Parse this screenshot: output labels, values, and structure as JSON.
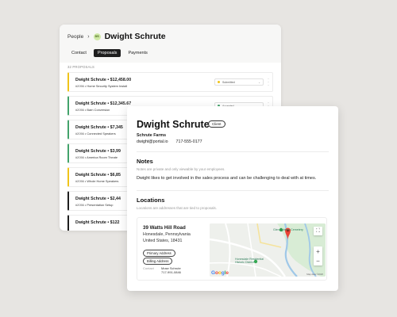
{
  "back": {
    "breadcrumb": "People",
    "avatar_initials": "DS",
    "title": "Dwight Schrute",
    "tabs": [
      {
        "label": "Contact",
        "active": false
      },
      {
        "label": "Proposals",
        "active": true
      },
      {
        "label": "Payments",
        "active": false
      }
    ],
    "section_label": "32 PROPOSALS",
    "rows": [
      {
        "name": "Dwight Schrute",
        "amount": "$12,458.00",
        "id": "#2056",
        "desc": "Home Security System Install",
        "color": "#f0c419",
        "status": "Submitted"
      },
      {
        "name": "Dwight Schrute",
        "amount": "$12,345.67",
        "id": "#2056",
        "desc": "Barn Conversion",
        "color": "#43a36b",
        "status": "Accepted"
      },
      {
        "name": "Dwight Schrute",
        "amount": "$7,345",
        "id": "#2056",
        "desc": "Connected Speakers",
        "color": "#43a36b",
        "status": ""
      },
      {
        "name": "Dwight Schrute",
        "amount": "$3,99",
        "id": "#2056",
        "desc": "America Room Theate",
        "color": "#43a36b",
        "status": ""
      },
      {
        "name": "Dwight Schrute",
        "amount": "$6,85",
        "id": "#2056",
        "desc": "Whole Home Speakers",
        "color": "#f0c419",
        "status": ""
      },
      {
        "name": "Dwight Schrute",
        "amount": "$2,44",
        "id": "#2056",
        "desc": "Presentation Setup",
        "color": "#1e1e1e",
        "status": ""
      },
      {
        "name": "Dwight Schrute",
        "amount": "$122",
        "id": "",
        "desc": "",
        "color": "#1e1e1e",
        "status": ""
      }
    ]
  },
  "front": {
    "name": "Dwight Schrute",
    "badge": "Client",
    "company": "Schrute Farms",
    "email": "dwight@portal.io",
    "phone": "717-555-0177",
    "notes": {
      "heading": "Notes",
      "hint": "Notes are private and only viewable by your employees.",
      "text": "Dwight likes to get involved in the sales process and can be challenging to deal with at times."
    },
    "locations": {
      "heading": "Locations",
      "hint": "Locations are addresses that are tied to proposals.",
      "address_line1": "39 Watts Hill Road",
      "address_line2": "Honesdale, Pennsylvania",
      "address_line3": "United States, 18431",
      "chips": [
        "Primary Address",
        "Billing Address"
      ],
      "contact_label": "Contact",
      "contact_name": "Mose Schrute",
      "contact_phone": "717-991-0846",
      "map": {
        "label_cemetery": "Glen Dyberry Cemetery",
        "label_district_1": "Honesdale Residential",
        "label_district_2": "Historic District",
        "google": [
          "G",
          "o",
          "o",
          "g",
          "l",
          "e"
        ],
        "mapdata": "Map data ©2020"
      }
    }
  },
  "colors": {
    "accent_green": "#43a36b",
    "accent_yellow": "#f0c419",
    "pin_red": "#ea4335"
  }
}
